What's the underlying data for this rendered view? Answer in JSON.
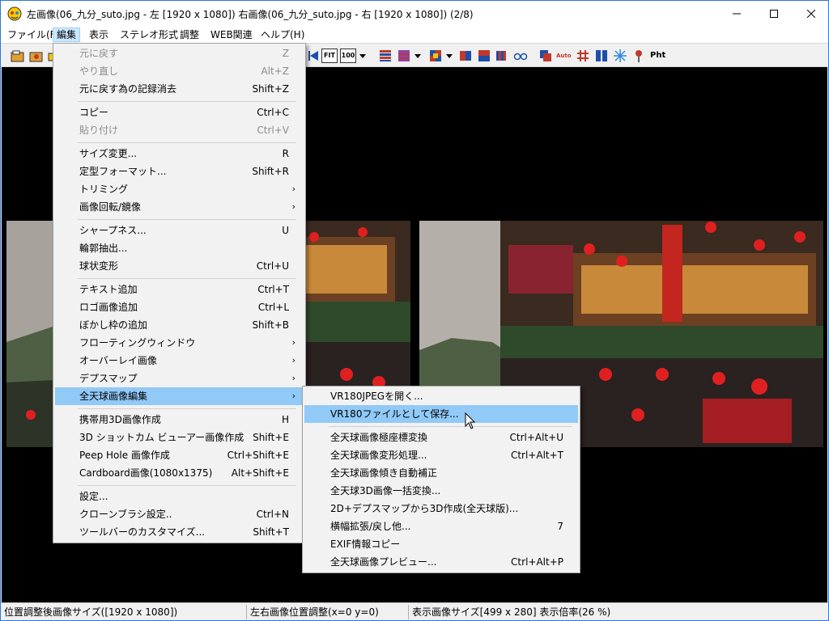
{
  "window": {
    "title": "左画像(06_九分_suto.jpg - 左 [1920 x 1080]) 右画像(06_九分_suto.jpg - 右 [1920 x 1080]) (2/8)",
    "controls": {
      "minimize": "—",
      "maximize": "☐",
      "close": "✕"
    }
  },
  "menubar": {
    "items": [
      "ファイル(F)",
      "編集",
      "表示",
      "ステレオ形式",
      "調整",
      "WEB関連",
      "ヘルプ(H)"
    ],
    "active_index": 1
  },
  "toolbar": {
    "fit_label": "FIT",
    "hundred_label": "100",
    "pht_label": "Pht",
    "auto_label": "Auto"
  },
  "edit_menu": {
    "items": [
      {
        "label": "元に戻す",
        "shortcut": "Z",
        "disabled": true
      },
      {
        "label": "やり直し",
        "shortcut": "Alt+Z",
        "disabled": true
      },
      {
        "label": "元に戻す為の記録消去",
        "shortcut": "Shift+Z"
      },
      {
        "label": "コピー",
        "shortcut": "Ctrl+C"
      },
      {
        "label": "貼り付け",
        "shortcut": "Ctrl+V",
        "disabled": true
      },
      {
        "label": "サイズ変更...",
        "shortcut": "R"
      },
      {
        "label": "定型フォーマット...",
        "shortcut": "Shift+R"
      },
      {
        "label": "トリミング",
        "submenu": true
      },
      {
        "label": "画像回転/鏡像",
        "submenu": true
      },
      {
        "label": "シャープネス...",
        "shortcut": "U"
      },
      {
        "label": "輪郭抽出..."
      },
      {
        "label": "球状変形",
        "shortcut": "Ctrl+U"
      },
      {
        "label": "テキスト追加",
        "shortcut": "Ctrl+T"
      },
      {
        "label": "ロゴ画像追加",
        "shortcut": "Ctrl+L"
      },
      {
        "label": "ぼかし枠の追加",
        "shortcut": "Shift+B"
      },
      {
        "label": "フローティングウィンドウ",
        "submenu": true
      },
      {
        "label": "オーバーレイ画像",
        "submenu": true
      },
      {
        "label": "デプスマップ",
        "submenu": true
      },
      {
        "label": "全天球画像編集",
        "submenu": true,
        "highlighted": true
      },
      {
        "label": "携帯用3D画像作成",
        "shortcut": "H"
      },
      {
        "label": "3D ショットカム ビューアー画像作成",
        "shortcut": "Shift+E"
      },
      {
        "label": "Peep Hole 画像作成",
        "shortcut": "Ctrl+Shift+E"
      },
      {
        "label": "Cardboard画像(1080x1375)",
        "shortcut": "Alt+Shift+E"
      },
      {
        "label": "設定..."
      },
      {
        "label": "クローンブラシ設定..",
        "shortcut": "Ctrl+N"
      },
      {
        "label": "ツールバーのカスタマイズ...",
        "shortcut": "Shift+T"
      }
    ]
  },
  "submenu": {
    "items": [
      {
        "label": "VR180JPEGを開く..."
      },
      {
        "label": "VR180ファイルとして保存...",
        "highlighted": true
      },
      {
        "label": "全天球画像極座標変換",
        "shortcut": "Ctrl+Alt+U"
      },
      {
        "label": "全天球画像変形処理...",
        "shortcut": "Ctrl+Alt+T"
      },
      {
        "label": "全天球画像傾き自動補正"
      },
      {
        "label": "全天球3D画像一括変換..."
      },
      {
        "label": "2D+デプスマップから3D作成(全天球版)..."
      },
      {
        "label": "横幅拡張/戻し他...",
        "shortcut": "7"
      },
      {
        "label": "EXIF情報コピー"
      },
      {
        "label": "全天球画像プレビュー...",
        "shortcut": "Ctrl+Alt+P"
      }
    ]
  },
  "statusbar": {
    "cells": [
      "位置調整後画像サイズ([1920 x 1080])",
      "左右画像位置調整(x=0 y=0)",
      "表示画像サイズ[499 x 280]  表示倍率(26 %)"
    ]
  }
}
